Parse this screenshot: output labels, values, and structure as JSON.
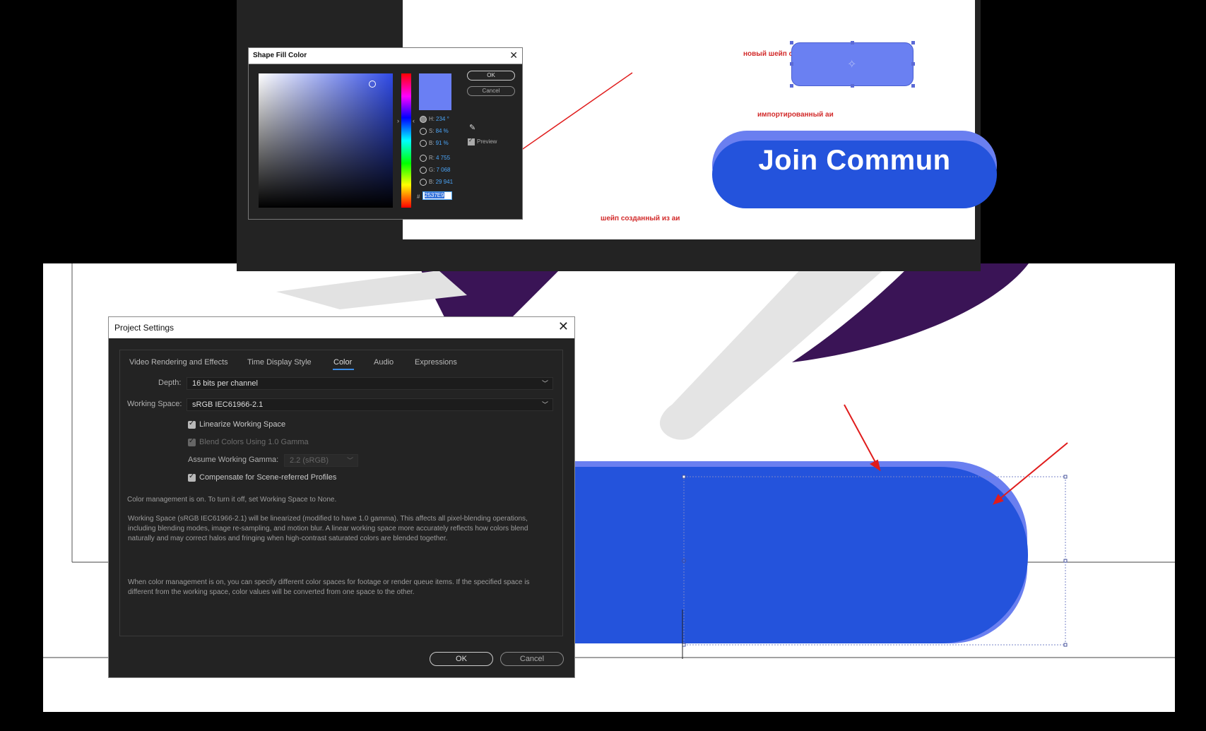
{
  "top_screenshot": {
    "annotations": {
      "new_shape": "новый шейп с цветом взятым пипеткой",
      "imported_ai": "импортированный аи",
      "shape_from_ai": "шейп созданный из аи"
    },
    "button_text": "Join Commun",
    "fill_dialog": {
      "title": "Shape Fill Color",
      "ok_label": "OK",
      "cancel_label": "Cancel",
      "preview_label": "Preview",
      "fields": [
        {
          "key": "H:",
          "value": "234 °"
        },
        {
          "key": "S:",
          "value": "84 %"
        },
        {
          "key": "B:",
          "value": "91 %"
        },
        {
          "key": "R:",
          "value": "4 755"
        },
        {
          "key": "G:",
          "value": "7 068"
        },
        {
          "key": "B:",
          "value": "29 941"
        }
      ],
      "hex_label": "#",
      "hex_value": "2537E9",
      "swatch_color": "#6a7ff4"
    }
  },
  "project_settings": {
    "title": "Project Settings",
    "tabs": [
      "Video Rendering and Effects",
      "Time Display Style",
      "Color",
      "Audio",
      "Expressions"
    ],
    "active_tab": "Color",
    "depth_label": "Depth:",
    "depth_value": "16 bits per channel",
    "working_space_label": "Working Space:",
    "working_space_value": "sRGB IEC61966-2.1",
    "linearize_label": "Linearize Working Space",
    "blend_label": "Blend Colors Using 1.0 Gamma",
    "gamma_label": "Assume Working Gamma:",
    "gamma_value": "2.2 (sRGB)",
    "compensate_label": "Compensate for Scene-referred Profiles",
    "info_1": "Color management is on. To turn it off, set Working Space to None.",
    "info_2": "Working Space (sRGB IEC61966-2.1) will be linearized (modified to have 1.0 gamma). This affects all pixel-blending operations, including blending modes, image re-sampling, and motion blur. A linear working space more accurately reflects how colors blend naturally and may correct halos and fringing when high-contrast saturated colors are blended together.",
    "info_3": "When color management is on, you can specify different color spaces for footage or render queue items. If the specified space is different from the working space, color values will be converted from one space to the other.",
    "ok_label": "OK",
    "cancel_label": "Cancel"
  },
  "colors": {
    "shape_front": "#2453dc",
    "shape_back": "#6a7ff0",
    "annotation_red": "#d22a2a",
    "accent_blue": "#3b8ce6",
    "purple": "#3a1456"
  }
}
